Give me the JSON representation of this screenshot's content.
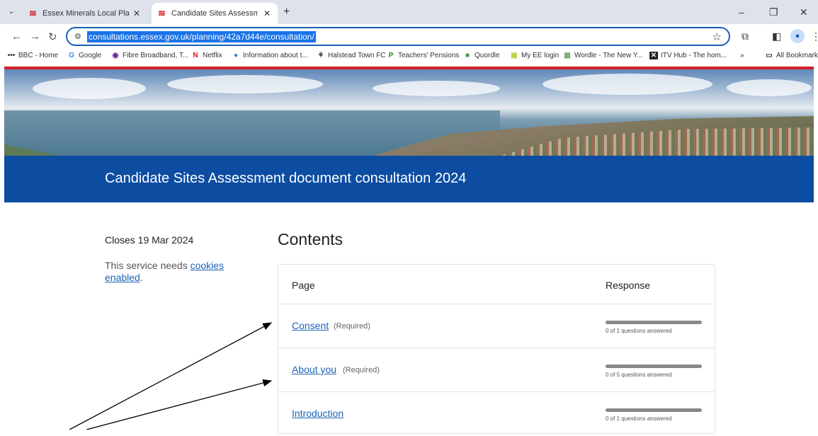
{
  "browser": {
    "tabs": [
      {
        "title": "Essex Minerals Local Plan Revie",
        "active": false
      },
      {
        "title": "Candidate Sites Assessment do",
        "active": true
      }
    ],
    "url": "consultations.essex.gov.uk/planning/42a7d44e/consultation/",
    "bookmarks": [
      {
        "icon": "•••",
        "label": "BBC - Home"
      },
      {
        "icon": "G",
        "label": "Google"
      },
      {
        "icon": "◉",
        "label": "Fibre Broadband, T..."
      },
      {
        "icon": "N",
        "label": "Netflix"
      },
      {
        "icon": "●",
        "label": "Information about t..."
      },
      {
        "icon": "⚘",
        "label": "Halstead Town FC"
      },
      {
        "icon": "P",
        "label": "Teachers' Pensions"
      },
      {
        "icon": "■",
        "label": "Quordle"
      },
      {
        "icon": "▣",
        "label": "My EE login"
      },
      {
        "icon": "▦",
        "label": "Wordle - The New Y..."
      },
      {
        "icon": "✕",
        "label": "ITV Hub - The hom..."
      }
    ],
    "all_bookmarks": "All Bookmarks",
    "accent": "#1a73e8"
  },
  "page": {
    "banner_title": "Candidate Sites Assessment document consultation 2024",
    "banner_color": "#0c4da2",
    "closes": "Closes 19 Mar 2024",
    "cookie_prefix": "This service needs ",
    "cookie_link": "cookies enabled",
    "cookie_suffix": ".",
    "contents_heading": "Contents",
    "table": {
      "col_page": "Page",
      "col_response": "Response",
      "rows": [
        {
          "title": "Consent",
          "required": "(Required)",
          "status": "0 of 1 questions answered",
          "progress": 0
        },
        {
          "title": "About you",
          "required": "(Required)",
          "status": "0 of 5 questions answered",
          "progress": 0
        },
        {
          "title": "Introduction",
          "required": "",
          "status": "0 of 1 questions answered",
          "progress": 0
        }
      ]
    }
  }
}
